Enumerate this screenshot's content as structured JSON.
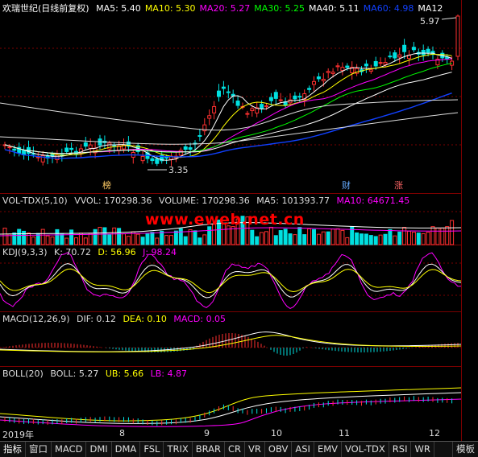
{
  "main": {
    "title": "欢瑞世纪(日线前复权)",
    "ma": [
      {
        "label": "MA5: 5.40",
        "color": "#ffffff"
      },
      {
        "label": "MA10: 5.30",
        "color": "#ffff00"
      },
      {
        "label": "MA20: 5.27",
        "color": "#ff00ff"
      },
      {
        "label": "MA30: 5.25",
        "color": "#00ff00"
      },
      {
        "label": "MA40: 5.11",
        "color": "#ffffff"
      },
      {
        "label": "MA60: 4.98",
        "color": "#1040ff"
      },
      {
        "label": "MA12",
        "color": "#ffffff"
      }
    ],
    "high_label": "5.97",
    "low_label": "3.35",
    "markers": [
      "榜",
      "财",
      "涨"
    ]
  },
  "vol": {
    "name": "VOL-TDX(5,10)",
    "items": [
      {
        "label": "VVOL: 170298.36",
        "color": "#ffffff"
      },
      {
        "label": "VOLUME: 170298.36",
        "color": "#ffffff"
      },
      {
        "label": "MA5: 101393.77",
        "color": "#ffffff"
      },
      {
        "label": "MA10: 64671.45",
        "color": "#ff00ff"
      }
    ]
  },
  "kdj": {
    "name": "KDJ(9,3,3)",
    "items": [
      {
        "label": "K: 70.72",
        "color": "#ffffff"
      },
      {
        "label": "D: 56.96",
        "color": "#ffff00"
      },
      {
        "label": "J: 98.24",
        "color": "#ff00ff"
      }
    ]
  },
  "macd": {
    "name": "MACD(12,26,9)",
    "items": [
      {
        "label": "DIF: 0.12",
        "color": "#ffffff"
      },
      {
        "label": "DEA: 0.10",
        "color": "#ffff00"
      },
      {
        "label": "MACD: 0.05",
        "color": "#ff00ff"
      }
    ]
  },
  "boll": {
    "name": "BOLL(20)",
    "items": [
      {
        "label": "BOLL: 5.27",
        "color": "#ffffff"
      },
      {
        "label": "UB: 5.66",
        "color": "#ffff00"
      },
      {
        "label": "LB: 4.87",
        "color": "#ff00ff"
      }
    ]
  },
  "watermark": "www.eweb.net.cn",
  "xaxis": [
    "2019年",
    "8",
    "9",
    "10",
    "11",
    "12"
  ],
  "tabs": [
    "指标",
    "窗口",
    "MACD",
    "DMI",
    "DMA",
    "FSL",
    "TRIX",
    "BRAR",
    "CR",
    "VR",
    "OBV",
    "ASI",
    "EMV",
    "VOL-TDX",
    "RSI",
    "WR"
  ],
  "right_tab": "模板",
  "colors": {
    "up": "#ff3030",
    "down": "#00e0e0",
    "grid": "#7a0000",
    "bg": "#000000"
  }
}
